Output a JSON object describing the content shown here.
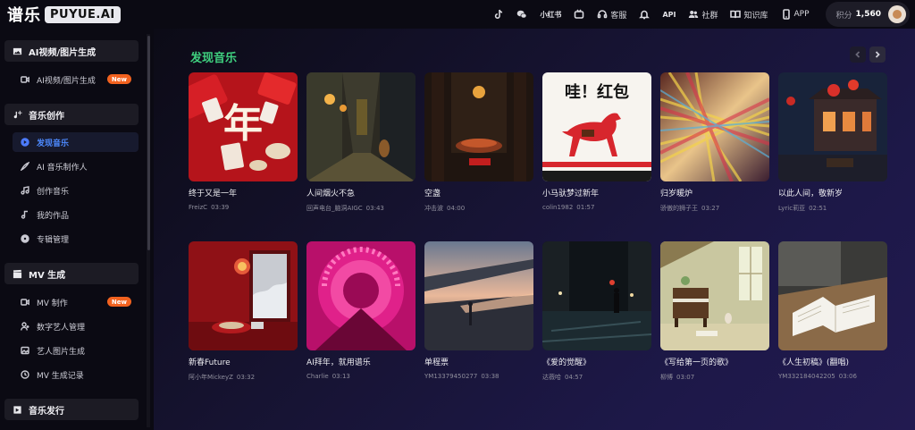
{
  "brand": {
    "name_cn": "谱乐",
    "name_en": "PUYUE.AI"
  },
  "header": {
    "icons": [
      "tiktok-icon",
      "wechat-icon"
    ],
    "xiaohongshu": "小红书",
    "bilibili": "bilibili-icon",
    "support": "客服",
    "api": "API",
    "community": "社群",
    "knowledge": "知识库",
    "app": "APP",
    "points_label": "积分",
    "points_value": "1,560"
  },
  "sidebar": {
    "sections": [
      {
        "title": "AI视频/图片生成",
        "icon": "image-icon",
        "items": [
          {
            "label": "AI视频/图片生成",
            "icon": "video-icon",
            "badge": "New"
          }
        ]
      },
      {
        "title": "音乐创作",
        "icon": "music-plus-icon",
        "items": [
          {
            "label": "发现音乐",
            "icon": "discover-icon",
            "active": true
          },
          {
            "label": "AI 音乐制作人",
            "icon": "pen-icon"
          },
          {
            "label": "创作音乐",
            "icon": "notes-icon"
          },
          {
            "label": "我的作品",
            "icon": "music-note-icon"
          },
          {
            "label": "专辑管理",
            "icon": "disc-icon"
          }
        ]
      },
      {
        "title": "MV 生成",
        "icon": "clapper-icon",
        "items": [
          {
            "label": "MV 制作",
            "icon": "video-icon",
            "badge": "New"
          },
          {
            "label": "数字艺人管理",
            "icon": "person-icon"
          },
          {
            "label": "艺人图片生成",
            "icon": "image-small-icon"
          },
          {
            "label": "MV 生成记录",
            "icon": "history-icon"
          }
        ]
      },
      {
        "title": "音乐发行",
        "icon": "release-icon",
        "items": []
      }
    ]
  },
  "main": {
    "section_title": "发现音乐",
    "songs": [
      {
        "title": "终于又是一年",
        "artist": "FreizC",
        "duration": "03:39"
      },
      {
        "title": "人间烟火不急",
        "artist": "回声电台_脑洞AIGC",
        "duration": "03:43"
      },
      {
        "title": "空盏",
        "artist": "冲击波",
        "duration": "04:00"
      },
      {
        "title": "小马驮梦过新年",
        "artist": "colin1982",
        "duration": "01:57"
      },
      {
        "title": "归岁暖炉",
        "artist": "骄傲的狮子王",
        "duration": "03:27"
      },
      {
        "title": "以此人间，敬新岁",
        "artist": "Lyric莉亚",
        "duration": "02:51"
      },
      {
        "title": "新春Future",
        "artist": "阿小年MickeyZ",
        "duration": "03:32"
      },
      {
        "title": "AI拜年，就用谱乐",
        "artist": "Charlie",
        "duration": "03:13"
      },
      {
        "title": "单程票",
        "artist": "YM13379450277",
        "duration": "03:38"
      },
      {
        "title": "《爱的觉醒》",
        "artist": "达薇哈",
        "duration": "04:57"
      },
      {
        "title": "《写给第一页的歌》",
        "artist": "柳博",
        "duration": "03:07"
      },
      {
        "title": "《人生初稿》(翻唱)",
        "artist": "YM332184042205",
        "duration": "03:06"
      }
    ],
    "covers": [
      {
        "desc": "red-new-year-cover"
      },
      {
        "desc": "alley-lantern-cover",
        "text": ""
      },
      {
        "desc": "teahouse-cover"
      },
      {
        "desc": "horse-poster-cover",
        "text": "哇！红包"
      },
      {
        "desc": "light-streak-cover"
      },
      {
        "desc": "lantern-street-cover"
      },
      {
        "desc": "red-room-snow-cover"
      },
      {
        "desc": "pink-spiral-cover"
      },
      {
        "desc": "station-sunset-cover"
      },
      {
        "desc": "night-street-cover"
      },
      {
        "desc": "piano-room-cover"
      },
      {
        "desc": "open-book-cover"
      }
    ]
  },
  "colors": {
    "accent": "#3fd07f",
    "active_nav": "#4d8aff",
    "badge": "#f2621f"
  }
}
